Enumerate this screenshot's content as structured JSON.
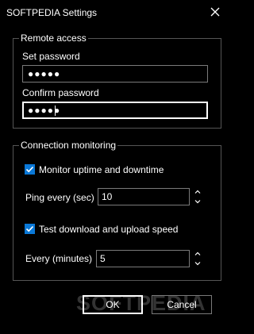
{
  "window": {
    "title": "SOFTPEDIA Settings"
  },
  "remote_access": {
    "legend": "Remote access",
    "set_password_label": "Set password",
    "set_password_value": "●●●●●",
    "confirm_password_label": "Confirm password",
    "confirm_password_value": "●●●●●"
  },
  "connection_monitoring": {
    "legend": "Connection monitoring",
    "monitor_uptime_label": "Monitor uptime and downtime",
    "monitor_uptime_checked": true,
    "ping_label": "Ping every (sec)",
    "ping_value": "10",
    "test_speed_label": "Test download and upload speed",
    "test_speed_checked": true,
    "every_minutes_label": "Every (minutes)",
    "every_minutes_value": "5"
  },
  "buttons": {
    "ok": "OK",
    "cancel": "Cancel"
  },
  "watermark": "SOFTPEDIA",
  "icons": {
    "close": "close-icon",
    "spin_up": "chevron-up-icon",
    "spin_down": "chevron-down-icon",
    "check": "checkmark-icon"
  },
  "colors": {
    "background": "#000000",
    "checkbox_accent": "#0a78d7",
    "border": "#7a7a7a",
    "focus_border": "#ffffff"
  }
}
